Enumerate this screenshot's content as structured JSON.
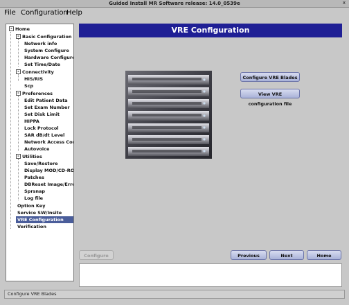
{
  "window": {
    "title": "Guided Install  MR Software release: 14.0_0539e",
    "close_glyph": "x"
  },
  "menubar": {
    "items": [
      "File",
      "Configuration",
      "Help"
    ]
  },
  "tree": {
    "items": [
      {
        "label": "Home",
        "toggle": "-"
      },
      {
        "label": "Basic Configuration",
        "toggle": "-"
      },
      {
        "label": "Network info"
      },
      {
        "label": "System Configure"
      },
      {
        "label": "Hardware Configure"
      },
      {
        "label": "Set Time/Date"
      },
      {
        "label": "Connectivity",
        "toggle": "-"
      },
      {
        "label": "HIS/RIS"
      },
      {
        "label": "Scp"
      },
      {
        "label": "Preferences",
        "toggle": "-"
      },
      {
        "label": "Edit Patient Data"
      },
      {
        "label": "Set Exam Number"
      },
      {
        "label": "Set Disk Limit"
      },
      {
        "label": "HIPPA"
      },
      {
        "label": "Lock Protocol"
      },
      {
        "label": "SAR dB/dt Level"
      },
      {
        "label": "Network Access Contro"
      },
      {
        "label": "Autovoice"
      },
      {
        "label": "Utilities",
        "toggle": "-"
      },
      {
        "label": "Save/Restore"
      },
      {
        "label": "Display MOD/CD-ROM"
      },
      {
        "label": "Patches"
      },
      {
        "label": "DBReset Image/Error DE"
      },
      {
        "label": "Sprsnap"
      },
      {
        "label": "Log file"
      },
      {
        "label": "Option Key"
      },
      {
        "label": "Service SW/Insite"
      },
      {
        "label": "VRE Configuration",
        "selected": true
      },
      {
        "label": "Verification"
      }
    ]
  },
  "page": {
    "title": "VRE Configuration"
  },
  "buttons": {
    "configure_vre_blades": "Configure VRE Blades",
    "view_vre_config_file": "View VRE configuration file",
    "configure": "Configure",
    "previous": "Previous",
    "next": "Next",
    "home": "Home"
  },
  "status": {
    "text": "Configure VRE Blades"
  },
  "colors": {
    "header_bg": "#1f1f95",
    "selection_bg": "#4a5d9a",
    "button_bg": "#b8c0e0"
  }
}
